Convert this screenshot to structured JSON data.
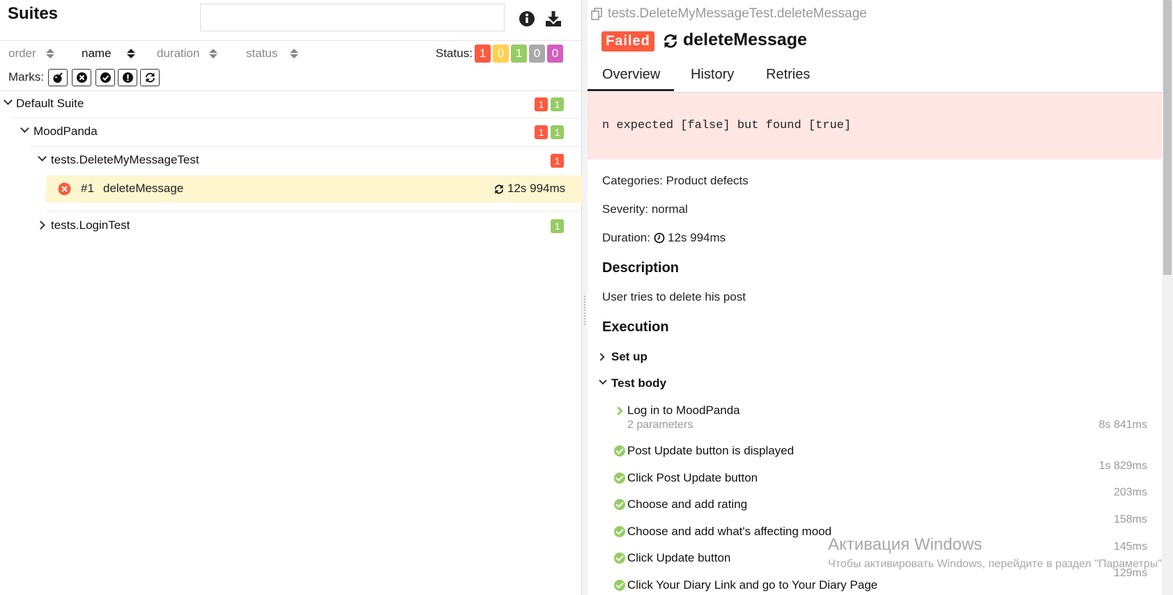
{
  "suites": {
    "title": "Suites",
    "search_placeholder": "",
    "sort": {
      "order": "order",
      "name": "name",
      "duration": "duration",
      "status": "status"
    },
    "status_label": "Status:",
    "status_counts": {
      "failed": "1",
      "broken": "0",
      "passed": "1",
      "skipped": "0",
      "unknown": "0"
    },
    "marks_label": "Marks:",
    "marks_icons": [
      "bomb-icon",
      "times-circle-icon",
      "check-circle-icon",
      "exclamation-circle-icon",
      "refresh-icon"
    ],
    "tree": {
      "default_suite": {
        "label": "Default Suite",
        "failed": "1",
        "passed": "1"
      },
      "moodpanda": {
        "label": "MoodPanda",
        "failed": "1",
        "passed": "1"
      },
      "delete_test": {
        "label": "tests.DeleteMyMessageTest",
        "failed": "1"
      },
      "test_case": {
        "number": "#1",
        "name": "deleteMessage",
        "duration": "12s 994ms"
      },
      "login_test": {
        "label": "tests.LoginTest",
        "passed": "1"
      }
    }
  },
  "detail": {
    "breadcrumb": "tests.DeleteMyMessageTest.deleteMessage",
    "status_badge": "Failed",
    "test_name": "deleteMessage",
    "tabs": [
      "Overview",
      "History",
      "Retries"
    ],
    "error_message": "n expected [false] but found [true]",
    "categories": "Categories: Product defects",
    "severity": "Severity: normal",
    "duration_label": "Duration:",
    "duration_value": "12s 994ms",
    "description_heading": "Description",
    "description_text": "User tries to delete his post",
    "execution_heading": "Execution",
    "setup_label": "Set up",
    "test_body_label": "Test body",
    "steps": [
      {
        "name": "Log in to MoodPanda",
        "params": "2 parameters",
        "duration": "8s 841ms"
      },
      {
        "name": "Post Update button is displayed",
        "duration": "1s 829ms"
      },
      {
        "name": "Click Post Update button",
        "duration": "203ms"
      },
      {
        "name": "Choose and add rating",
        "duration": "158ms"
      },
      {
        "name": "Choose and add what's affecting mood",
        "duration": "145ms"
      },
      {
        "name": "Click Update button",
        "duration": "129ms"
      },
      {
        "name": "Click Your Diary Link and go to Your Diary Page",
        "duration": ""
      }
    ]
  },
  "watermark": {
    "title": "Активация Windows",
    "text": "Чтобы активировать Windows, перейдите в раздел \"Параметры\"."
  },
  "colors": {
    "failed": "#fd5a3e",
    "broken": "#ffd050",
    "passed": "#97cc64",
    "skipped": "#aaaaaa",
    "unknown": "#d35ebe",
    "selected_row": "#fdf6cf",
    "error_bg": "#fee6e3"
  }
}
